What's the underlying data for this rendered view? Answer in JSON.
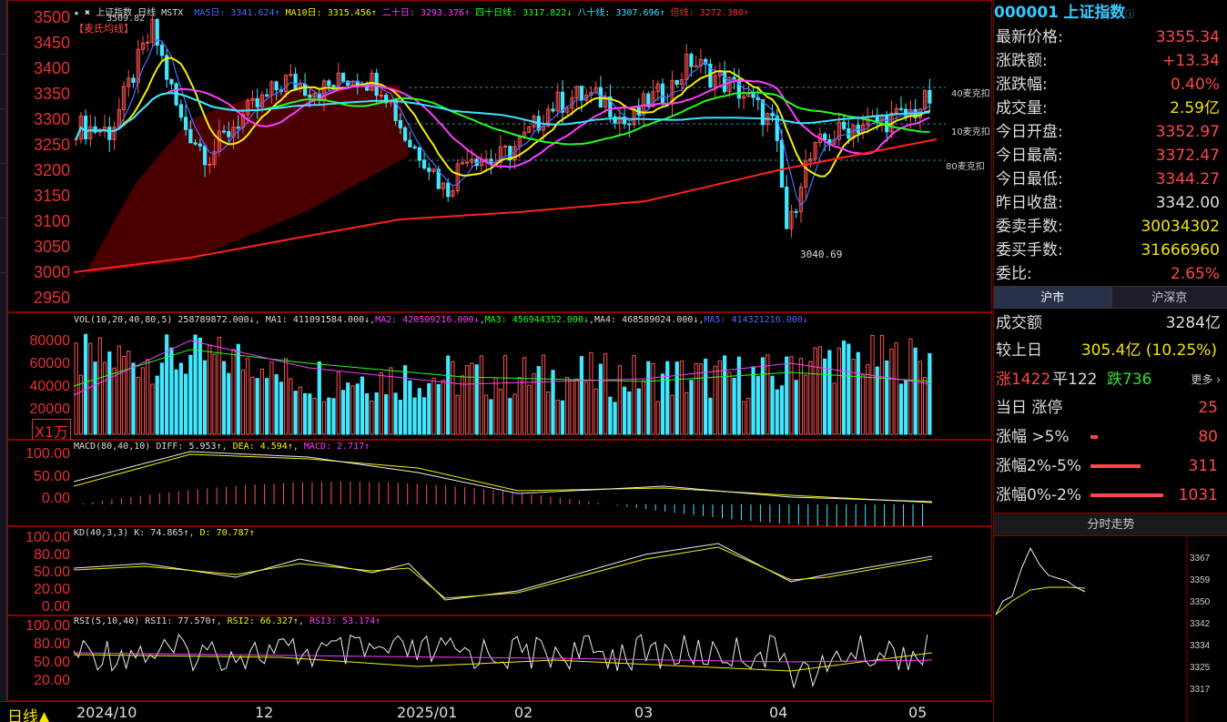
{
  "header": {
    "name": "上证指数",
    "period": "日线",
    "code_tag": "MSTX",
    "indicators": [
      {
        "label": "MA5日: 3341.624↑",
        "color": "#4a6cff"
      },
      {
        "label": "MA10日: 3315.456↑",
        "color": "#f2f200"
      },
      {
        "label": "二十日: 3293.376↑",
        "color": "#ff3cff"
      },
      {
        "label": "四十日线: 3317.822↓",
        "color": "#20ff20"
      },
      {
        "label": "八十线: 3307.696↑",
        "color": "#40e0ff"
      },
      {
        "label": "倍线: 3272.380↑",
        "color": "#ff3030"
      }
    ],
    "subtitle": "【麦氏均线】",
    "left_peak": "3509.82",
    "low_mark": "3040.69",
    "line_tags": [
      "40麦克扣",
      "10麦克扣",
      "80麦克扣"
    ]
  },
  "price_axis": [
    "3500",
    "3450",
    "3400",
    "3350",
    "3300",
    "3250",
    "3200",
    "3150",
    "3100",
    "3050",
    "3000",
    "2950"
  ],
  "vol": {
    "header": "VOL(10,20,40,80,5)",
    "value": "258789872.000↓",
    "ma1": "MA1: 411091584.000↓",
    "ma2": "MA2: 420509216.000↓",
    "ma3": "MA3: 456944352.000↓",
    "ma4": "MA4: 468589024.000↓",
    "ma5": "MA5: 414321216.000↓",
    "axis": [
      "80000",
      "60000",
      "40000",
      "20000"
    ],
    "unit": "X1万"
  },
  "macd": {
    "header": "MACD(80,40,10)",
    "diff": "DIFF: 5.953↑",
    "dea": "DEA: 4.594↑",
    "macd": "MACD: 2.717↑",
    "axis": [
      "100.00",
      "50.00",
      "0.00"
    ]
  },
  "kd": {
    "header": "KD(40,3,3)",
    "k": "K: 74.865↑",
    "d": "D: 70.787↑",
    "axis": [
      "100.00",
      "80.00",
      "50.00",
      "20.00",
      "0.00"
    ]
  },
  "rsi": {
    "header": "RSI(5,10,40)",
    "rsi1": "RSI1: 77.570↑",
    "rsi2": "RSI2: 66.327↑",
    "rsi3": "RSI3: 53.174↑",
    "axis": [
      "100.00",
      "80.00",
      "50.00",
      "20.00"
    ]
  },
  "x_axis": {
    "period_button": "日线▲",
    "ticks": [
      "2024/10",
      "12",
      "2025/01",
      "02",
      "03",
      "04",
      "05"
    ]
  },
  "quote": {
    "code": "000001",
    "name": "上证指数",
    "rows": [
      {
        "k": "最新价格:",
        "v": "3355.34",
        "c": "red"
      },
      {
        "k": "涨跌额:",
        "v": "+13.34",
        "c": "red"
      },
      {
        "k": "涨跌幅:",
        "v": "0.40%",
        "c": "red"
      },
      {
        "k": "成交量:",
        "v": "2.59亿",
        "c": "yel"
      },
      {
        "k": "今日开盘:",
        "v": "3352.97",
        "c": "red"
      },
      {
        "k": "今日最高:",
        "v": "3372.47",
        "c": "red"
      },
      {
        "k": "今日最低:",
        "v": "3344.27",
        "c": "red"
      },
      {
        "k": "昨日收盘:",
        "v": "3342.00",
        "c": "wht"
      },
      {
        "k": "委卖手数:",
        "v": "30034302",
        "c": "yel"
      },
      {
        "k": "委买手数:",
        "v": "31666960",
        "c": "yel"
      },
      {
        "k": "委比:",
        "v": "2.65%",
        "c": "red"
      }
    ]
  },
  "market": {
    "tabs": [
      "沪市",
      "沪深京"
    ],
    "turnover_label": "成交额",
    "turnover": "3284亿",
    "vs_label": "较上日",
    "vs": "305.4亿 (10.25%)",
    "up": "涨1422",
    "flat": "平122",
    "down": "跌736",
    "more": "更多 ›",
    "limits": [
      {
        "k": "当日 涨停",
        "v": "25",
        "w": 0
      },
      {
        "k": "涨幅 >5%",
        "v": "80",
        "w": 3
      },
      {
        "k": "涨幅2%-5%",
        "v": "311",
        "w": 22
      },
      {
        "k": "涨幅0%-2%",
        "v": "1031",
        "w": 78
      }
    ]
  },
  "intraday": {
    "title": "分时走势",
    "axis": [
      "3367",
      "3359",
      "3350",
      "3342",
      "3334",
      "3325",
      "3317"
    ]
  }
}
